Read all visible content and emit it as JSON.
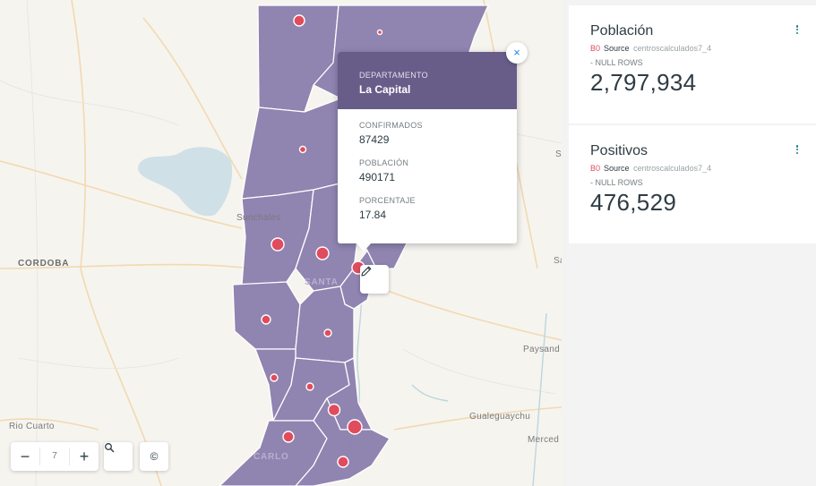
{
  "map": {
    "labels": {
      "cordoba": "CORDOBA",
      "sunchales": "Sunchales",
      "santa_fe": "SANTA",
      "parana_s": "S",
      "santa_right": "Sa",
      "paysandu": "Paysand",
      "rio_cuarto": "Rio Cuarto",
      "gualeguaychu": "Gualeguaychu",
      "mercedes": "Merced",
      "carlos": "CARLO"
    },
    "zoom_level": "7",
    "zoom_out": "−",
    "zoom_in": "+",
    "search_icon": "magnifier-icon",
    "attribution": "©"
  },
  "popup": {
    "department_label": "DEPARTAMENTO",
    "department_value": "La Capital",
    "confirmados_label": "CONFIRMADOS",
    "confirmados_value": "87429",
    "poblacion_label": "POBLACIÓN",
    "poblacion_value": "490171",
    "porcentaje_label": "PORCENTAJE",
    "porcentaje_value": "17.84",
    "close": "×"
  },
  "widgets": [
    {
      "title": "Población",
      "tag": "B0",
      "source_label": "Source",
      "source_name": "centroscalculados7_4",
      "nulls": "- NULL ROWS",
      "value": "2,797,934"
    },
    {
      "title": "Positivos",
      "tag": "B0",
      "source_label": "Source",
      "source_name": "centroscalculados7_4",
      "nulls": "- NULL ROWS",
      "value": "476,529"
    }
  ],
  "colors": {
    "region_fill": "#8b7fae",
    "region_stroke": "#ffffff",
    "bubble": "#e04c5d",
    "popup_header": "#685d89",
    "accent": "#1785fb"
  }
}
